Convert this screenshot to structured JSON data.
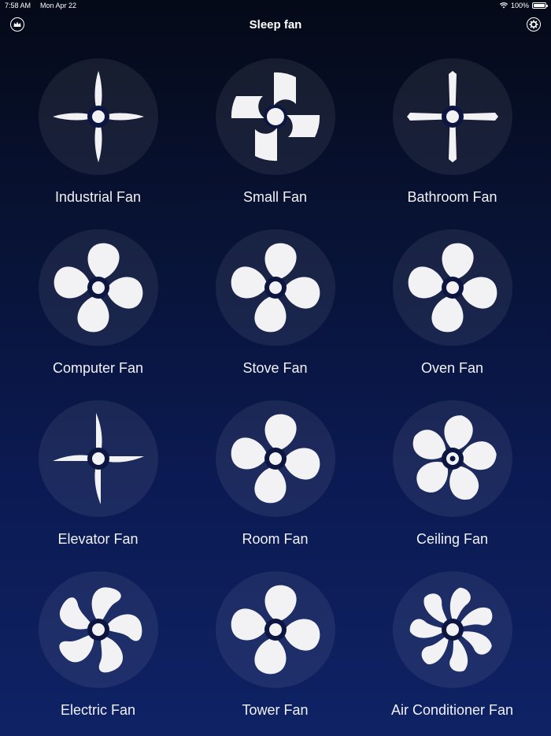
{
  "status": {
    "time": "7:58 AM",
    "date": "Mon Apr 22",
    "battery": "100%"
  },
  "nav": {
    "title": "Sleep fan",
    "left_icon": "crown-icon",
    "right_icon": "gear-icon"
  },
  "fans": [
    {
      "label": "Industrial Fan",
      "style": "slim4"
    },
    {
      "label": "Small Fan",
      "style": "quarter4"
    },
    {
      "label": "Bathroom Fan",
      "style": "plank4"
    },
    {
      "label": "Computer Fan",
      "style": "round4"
    },
    {
      "label": "Stove Fan",
      "style": "round4"
    },
    {
      "label": "Oven Fan",
      "style": "round4"
    },
    {
      "label": "Elevator Fan",
      "style": "thin4"
    },
    {
      "label": "Room Fan",
      "style": "round4"
    },
    {
      "label": "Ceiling Fan",
      "style": "round5"
    },
    {
      "label": "Electric Fan",
      "style": "curve5"
    },
    {
      "label": "Tower Fan",
      "style": "round4"
    },
    {
      "label": "Air Conditioner Fan",
      "style": "curve7"
    }
  ],
  "colors": {
    "blade": "#f2f2f5",
    "hub_ring": "#0c1640"
  }
}
